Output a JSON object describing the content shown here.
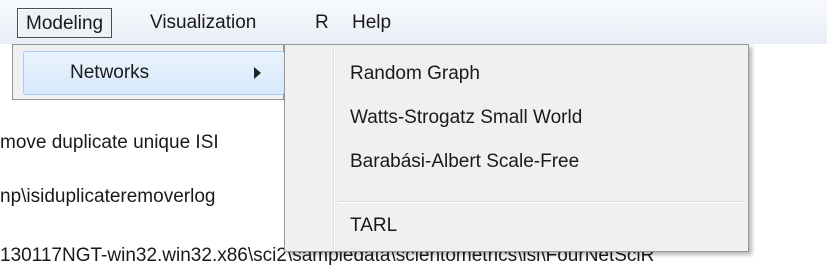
{
  "menubar": {
    "items": [
      {
        "label": "Modeling"
      },
      {
        "label": "Visualization"
      },
      {
        "label": "R"
      },
      {
        "label": "Help"
      }
    ]
  },
  "submenu": {
    "networks_label": "Networks"
  },
  "dropdown": {
    "items": [
      {
        "label": "Random Graph"
      },
      {
        "label": "Watts-Strogatz Small World"
      },
      {
        "label": "Barabási-Albert Scale-Free"
      },
      {
        "label": "TARL"
      }
    ]
  },
  "console": {
    "lines": [
      "move duplicate unique ISI",
      "np\\isiduplicateremoverlog",
      "130117NGT-win32.win32.x86\\sci2\\sampledata\\scientometrics\\isi\\FourNetSciR"
    ]
  }
}
